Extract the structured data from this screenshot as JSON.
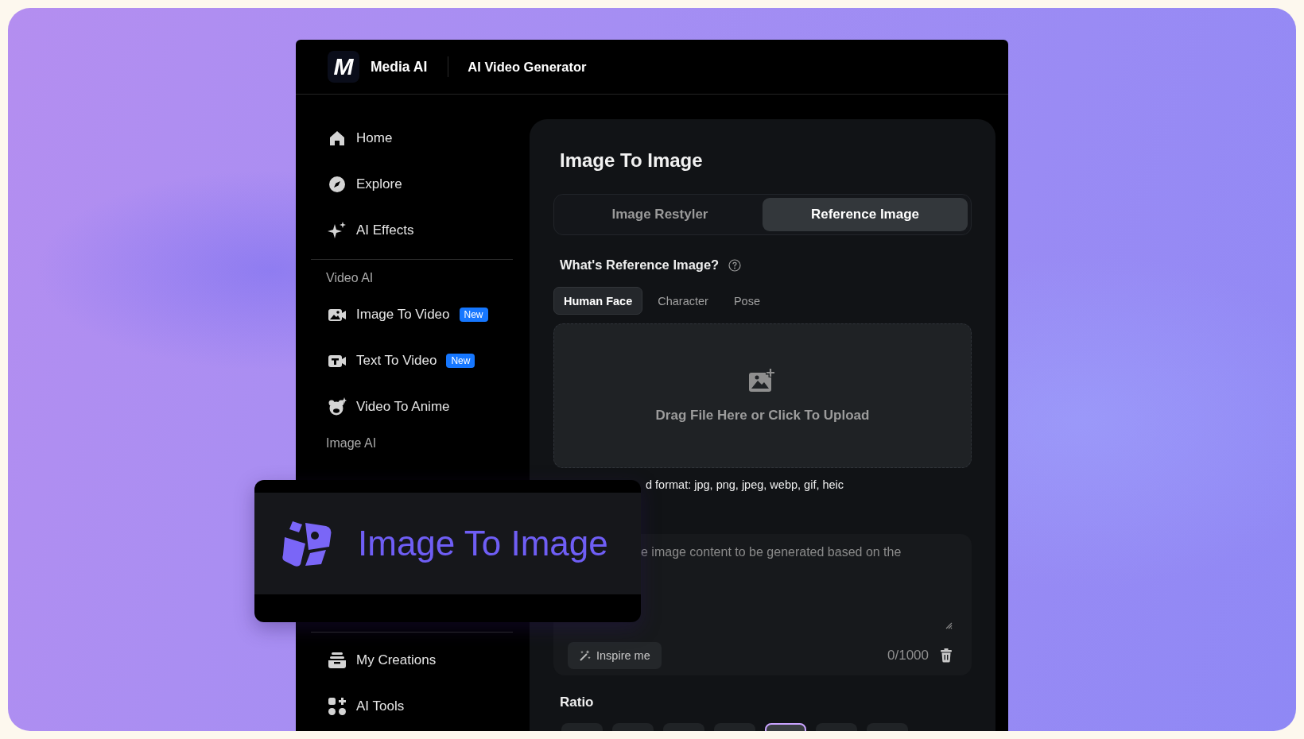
{
  "header": {
    "logo_mark": "M",
    "brand": "Media AI",
    "title": "AI Video Generator"
  },
  "sidebar": {
    "top_items": [
      {
        "label": "Home",
        "kind": "home"
      },
      {
        "label": "Explore",
        "kind": "compass"
      },
      {
        "label": "AI Effects",
        "kind": "sparkle"
      }
    ],
    "sections": [
      {
        "heading": "Video AI",
        "items": [
          {
            "label": "Image To Video",
            "kind": "image-video",
            "badge": "New"
          },
          {
            "label": "Text To Video",
            "kind": "text-video",
            "badge": "New"
          },
          {
            "label": "Video To Anime",
            "kind": "bear"
          }
        ]
      },
      {
        "heading": "Image AI"
      }
    ],
    "bottom_items": [
      {
        "label": "My Creations",
        "kind": "tray"
      },
      {
        "label": "AI Tools",
        "kind": "grid"
      }
    ]
  },
  "main": {
    "title": "Image To Image",
    "tabs": [
      {
        "label": "Image Restyler",
        "selected": false
      },
      {
        "label": "Reference Image",
        "selected": true
      }
    ],
    "question": "What's Reference Image?",
    "subtabs": [
      {
        "label": "Human Face",
        "selected": true
      },
      {
        "label": "Character",
        "selected": false
      },
      {
        "label": "Pose",
        "selected": false
      }
    ],
    "upload_text": "Drag File Here or Click To Upload",
    "format_note": "d format: jpg, png, jpeg, webp, gif, heic",
    "prompt": {
      "placeholder": "e image content to be generated based on the"
    },
    "inspire_button": "Inspire me",
    "counter": "0/1000",
    "ratio": {
      "label": "Ratio",
      "options": [
        {
          "selected": false
        },
        {
          "selected": false
        },
        {
          "selected": false
        },
        {
          "selected": false
        },
        {
          "selected": true
        },
        {
          "selected": false
        },
        {
          "selected": false
        }
      ]
    }
  },
  "callout": {
    "label": "Image To Image"
  }
}
